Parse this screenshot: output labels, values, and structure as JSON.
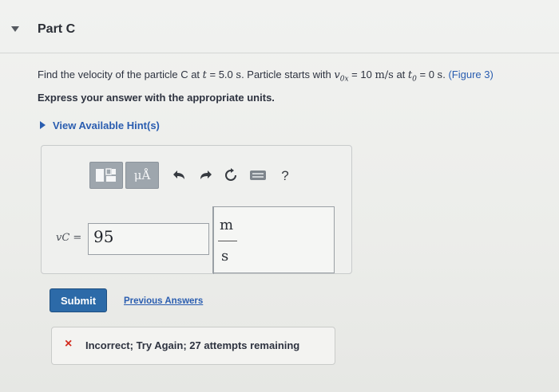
{
  "part": {
    "title": "Part C"
  },
  "question": {
    "t1": "Find the velocity of the particle C at ",
    "var_t": "t",
    "t2": " = 5.0 ",
    "unit_s1": "s",
    "t3": ". Particle starts with ",
    "var_v0x": "v",
    "sub_v0x": "0x",
    "t4": " = 10 ",
    "unit_ms": "m/s",
    "t5": " at ",
    "var_t0": "t",
    "sub_t0": "0",
    "t6": " = 0 ",
    "unit_s2": "s",
    "t7": ". ",
    "figure_link": "(Figure 3)"
  },
  "instruction": "Express your answer with the appropriate units.",
  "hints": {
    "label": "View Available Hint(s)"
  },
  "answer": {
    "variable_label": "vC =",
    "value": "95",
    "units_numerator": "m",
    "units_denominator": "s"
  },
  "toolbar": {
    "templates_icon": "templates-icon",
    "units_label": "μÅ",
    "undo_icon": "undo-icon",
    "redo_icon": "redo-icon",
    "reset_icon": "reset-icon",
    "keyboard_icon": "keyboard-icon",
    "help_label": "?"
  },
  "actions": {
    "submit_label": "Submit",
    "previous_answers_label": "Previous Answers"
  },
  "feedback": {
    "icon": "×",
    "message": "Incorrect; Try Again; 27 attempts remaining"
  },
  "colors": {
    "link": "#2a5db0",
    "submit_bg": "#2c6aa8",
    "error": "#d22a1d"
  }
}
